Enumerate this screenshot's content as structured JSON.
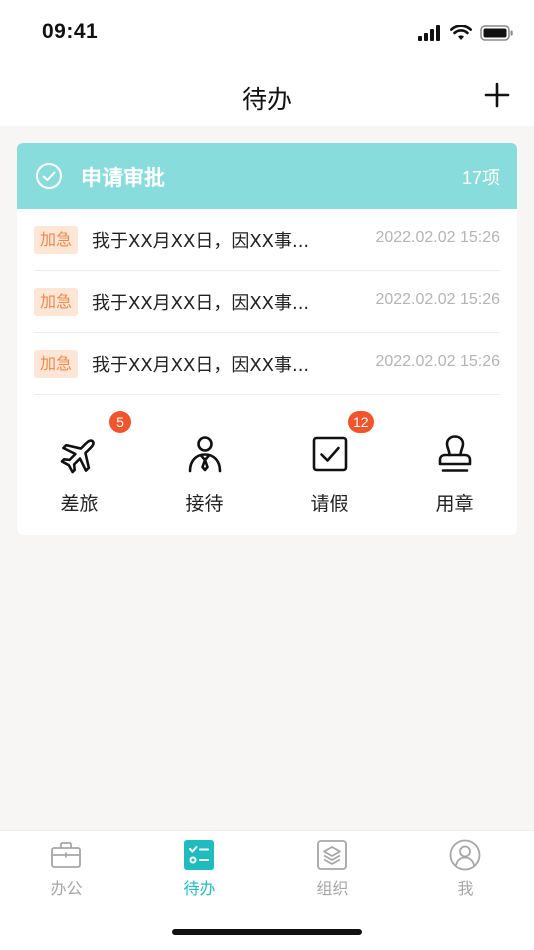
{
  "status_bar": {
    "time": "09:41"
  },
  "nav": {
    "title": "待办",
    "add_icon": "plus-icon"
  },
  "approval_card": {
    "title": "申请审批",
    "count": "17项",
    "header_color": "#88dcdc",
    "items": [
      {
        "tag": "加急",
        "text": "我于XX月XX日，因XX事...",
        "time": "2022.02.02 15:26"
      },
      {
        "tag": "加急",
        "text": "我于XX月XX日，因XX事...",
        "time": "2022.02.02 15:26"
      },
      {
        "tag": "加急",
        "text": "我于XX月XX日，因XX事...",
        "time": "2022.02.02 15:26"
      }
    ],
    "actions": [
      {
        "label": "差旅",
        "icon": "airplane-icon",
        "badge": "5"
      },
      {
        "label": "接待",
        "icon": "reception-person-icon",
        "badge": ""
      },
      {
        "label": "请假",
        "icon": "checkbox-icon",
        "badge": "12"
      },
      {
        "label": "用章",
        "icon": "stamp-icon",
        "badge": ""
      }
    ]
  },
  "tab_bar": {
    "active_color": "#1fbcbf",
    "tabs": [
      {
        "label": "办公",
        "icon": "briefcase-icon"
      },
      {
        "label": "待办",
        "icon": "todo-list-icon",
        "active": true
      },
      {
        "label": "组织",
        "icon": "layers-icon"
      },
      {
        "label": "我",
        "icon": "user-icon"
      }
    ]
  }
}
